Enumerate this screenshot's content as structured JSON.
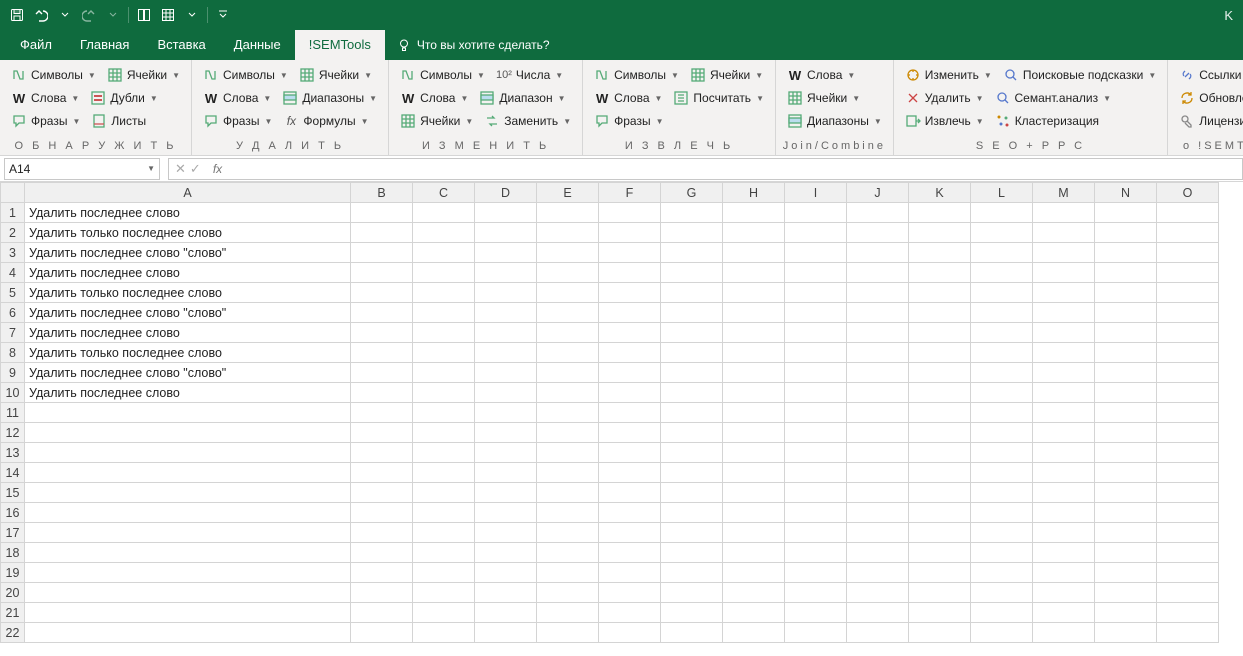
{
  "titlebar": {
    "k": "K"
  },
  "tabs": {
    "file": "Файл",
    "home": "Главная",
    "insert": "Вставка",
    "data": "Данные",
    "semtools": "!SEMTools",
    "tellme": "Что вы хотите сделать?"
  },
  "ribbon": {
    "groups": [
      {
        "name": "detect",
        "label": "О Б Н А Р У Ж И Т Ь",
        "rows": [
          [
            {
              "id": "symbols",
              "icon": "symbols",
              "label": "Символы",
              "dd": true
            },
            {
              "id": "cells",
              "icon": "cells",
              "label": "Ячейки",
              "dd": true
            }
          ],
          [
            {
              "id": "words",
              "icon": "wbold",
              "label": "Слова",
              "dd": true
            },
            {
              "id": "duplicates",
              "icon": "dupes",
              "label": "Дубли",
              "dd": true
            }
          ],
          [
            {
              "id": "phrases",
              "icon": "phrase",
              "label": "Фразы",
              "dd": true
            },
            {
              "id": "sheets",
              "icon": "sheets",
              "label": "Листы"
            }
          ]
        ]
      },
      {
        "name": "delete",
        "label": "У Д А Л И Т Ь",
        "rows": [
          [
            {
              "id": "symbols2",
              "icon": "symbols",
              "label": "Символы",
              "dd": true
            },
            {
              "id": "cells2",
              "icon": "cells",
              "label": "Ячейки",
              "dd": true
            }
          ],
          [
            {
              "id": "words2",
              "icon": "wbold",
              "label": "Слова",
              "dd": true
            },
            {
              "id": "ranges2",
              "icon": "ranges",
              "label": "Диапазоны",
              "dd": true
            }
          ],
          [
            {
              "id": "phrases2",
              "icon": "phrase",
              "label": "Фразы",
              "dd": true
            },
            {
              "id": "formulas2",
              "icon": "fx",
              "label": "Формулы",
              "dd": true
            }
          ]
        ]
      },
      {
        "name": "change",
        "label": "И З М Е Н И Т Ь",
        "rows": [
          [
            {
              "id": "symbols3",
              "icon": "symbols",
              "label": "Символы",
              "dd": true
            },
            {
              "id": "numbers3",
              "icon": "numbers",
              "label": "Числа",
              "dd": true
            }
          ],
          [
            {
              "id": "words3",
              "icon": "wbold",
              "label": "Слова",
              "dd": true
            },
            {
              "id": "range3",
              "icon": "ranges",
              "label": "Диапазон",
              "dd": true
            }
          ],
          [
            {
              "id": "cells3",
              "icon": "cells",
              "label": "Ячейки",
              "dd": true
            },
            {
              "id": "replace3",
              "icon": "replace",
              "label": "Заменить",
              "dd": true
            }
          ]
        ]
      },
      {
        "name": "extract",
        "label": "И З В Л Е Ч Ь",
        "rows": [
          [
            {
              "id": "symbols4",
              "icon": "symbols",
              "label": "Символы",
              "dd": true
            },
            {
              "id": "cells4",
              "icon": "cells",
              "label": "Ячейки",
              "dd": true
            }
          ],
          [
            {
              "id": "words4",
              "icon": "wbold",
              "label": "Слова",
              "dd": true
            },
            {
              "id": "count4",
              "icon": "count",
              "label": "Посчитать",
              "dd": true
            }
          ],
          [
            {
              "id": "phrases4",
              "icon": "phrase",
              "label": "Фразы",
              "dd": true
            }
          ]
        ]
      },
      {
        "name": "joincombine",
        "label": "Join/Combine",
        "rows": [
          [
            {
              "id": "words5",
              "icon": "wbold",
              "label": "Слова",
              "dd": true
            }
          ],
          [
            {
              "id": "cells5",
              "icon": "cells",
              "label": "Ячейки",
              "dd": true
            }
          ],
          [
            {
              "id": "ranges5",
              "icon": "ranges",
              "label": "Диапазоны",
              "dd": true
            }
          ]
        ]
      },
      {
        "name": "seoppc",
        "label": "S E O + P P C",
        "rows": [
          [
            {
              "id": "change6",
              "icon": "change",
              "label": "Изменить",
              "dd": true
            },
            {
              "id": "hints6",
              "icon": "hints",
              "label": "Поисковые подсказки",
              "dd": true
            }
          ],
          [
            {
              "id": "delete6",
              "icon": "delete",
              "label": "Удалить",
              "dd": true
            },
            {
              "id": "semant6",
              "icon": "semant",
              "label": "Семант.анализ",
              "dd": true
            }
          ],
          [
            {
              "id": "extract6",
              "icon": "extract",
              "label": "Извлечь",
              "dd": true
            },
            {
              "id": "cluster6",
              "icon": "cluster",
              "label": "Кластеризация"
            }
          ]
        ]
      },
      {
        "name": "about",
        "label": "о !SEMTools",
        "rows": [
          [
            {
              "id": "links7",
              "icon": "links",
              "label": "Ссылки",
              "dd": true
            }
          ],
          [
            {
              "id": "update7",
              "icon": "update",
              "label": "Обновление",
              "dd": true
            }
          ],
          [
            {
              "id": "license7",
              "icon": "license",
              "label": "Лицензия",
              "dd": true
            }
          ]
        ]
      }
    ]
  },
  "namebox": {
    "value": "A14"
  },
  "formula": {
    "value": ""
  },
  "columns": [
    "A",
    "B",
    "C",
    "D",
    "E",
    "F",
    "G",
    "H",
    "I",
    "J",
    "K",
    "L",
    "M",
    "N",
    "O"
  ],
  "rows": {
    "count": 22,
    "data": {
      "1": "Удалить последнее слово",
      "2": "Удалить только последнее слово",
      "3": "Удалить последнее слово \"слово\"",
      "4": "Удалить последнее слово",
      "5": "Удалить только последнее слово",
      "6": "Удалить последнее слово \"слово\"",
      "7": "Удалить последнее слово",
      "8": "Удалить только последнее слово",
      "9": "Удалить последнее слово \"слово\"",
      "10": "Удалить последнее слово"
    }
  }
}
